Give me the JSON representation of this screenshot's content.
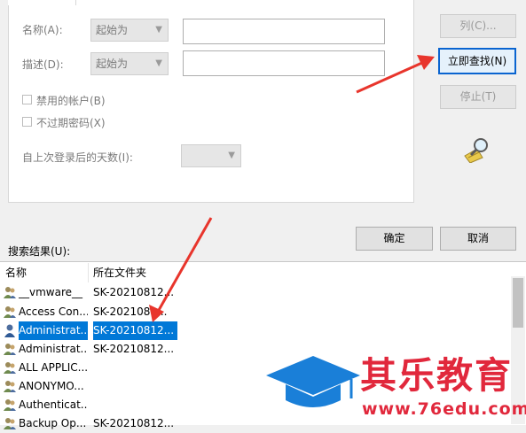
{
  "search_form": {
    "name_label": "名称(A):",
    "name_mode": "起始为",
    "name_value": "",
    "desc_label": "描述(D):",
    "desc_mode": "起始为",
    "desc_value": "",
    "disabled_accounts_label": "禁用的帐户(B)",
    "no_expire_label": "不过期密码(X)",
    "days_since_login_label": "自上次登录后的天数(I):",
    "days_since_login_value": ""
  },
  "buttons": {
    "columns": "列(C)...",
    "find_now": "立即查找(N)",
    "stop": "停止(T)",
    "ok": "确定",
    "cancel": "取消"
  },
  "results": {
    "label": "搜索结果(U):",
    "columns": [
      "名称",
      "所在文件夹"
    ],
    "rows": [
      {
        "name": "__vmware__",
        "folder": "SK-20210812..."
      },
      {
        "name": "Access Con...",
        "folder": "SK-2021081..."
      },
      {
        "name": "Administrat...",
        "folder": "SK-20210812...",
        "selected": true
      },
      {
        "name": "Administrat...",
        "folder": "SK-20210812..."
      },
      {
        "name": "ALL APPLIC...",
        "folder": ""
      },
      {
        "name": "ANONYMO...",
        "folder": ""
      },
      {
        "name": "Authenticat...",
        "folder": ""
      },
      {
        "name": "Backup Op...",
        "folder": "SK-20210812..."
      }
    ]
  },
  "watermark": {
    "brand": "其乐教育",
    "url": "www.76edu.com"
  },
  "colors": {
    "selection": "#0078d7",
    "annotation_arrow": "#e8352c",
    "brand_blue": "#1a7fd8",
    "brand_red": "#e1283c"
  }
}
